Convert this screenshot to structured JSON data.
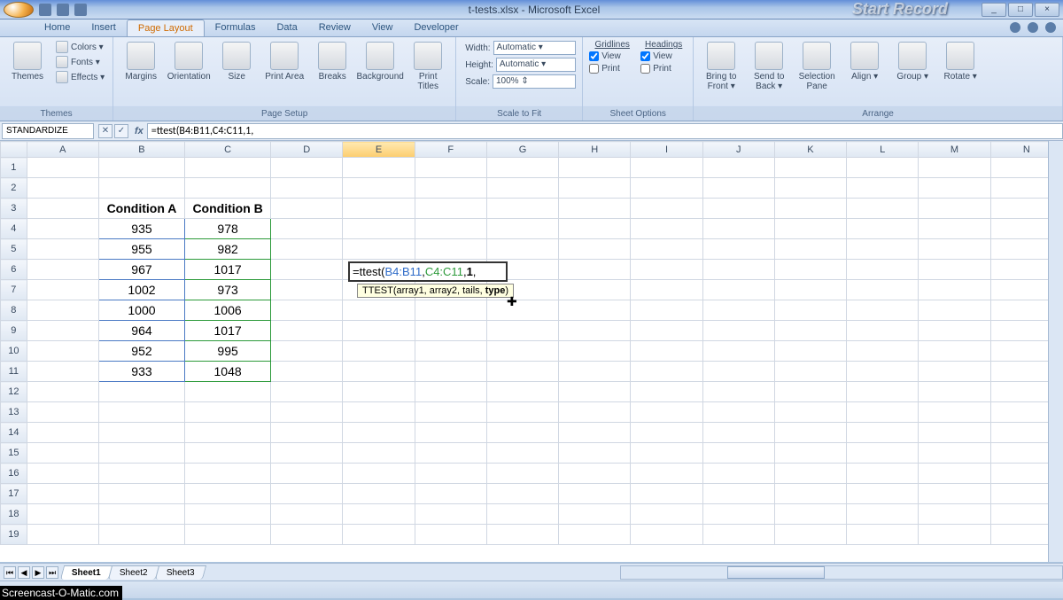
{
  "title": "t-tests.xlsx - Microsoft Excel",
  "watermark_top": "Start Record",
  "watermark_bottom": "Screencast-O-Matic.com",
  "window_buttons": {
    "min": "_",
    "max": "□",
    "close": "×"
  },
  "tabs": [
    "Home",
    "Insert",
    "Page Layout",
    "Formulas",
    "Data",
    "Review",
    "View",
    "Developer"
  ],
  "active_tab": 2,
  "ribbon": {
    "themes": {
      "label": "Themes",
      "btn": "Themes",
      "rows": [
        "Colors ▾",
        "Fonts ▾",
        "Effects ▾"
      ]
    },
    "page_setup": {
      "label": "Page Setup",
      "buttons": [
        "Margins",
        "Orientation",
        "Size",
        "Print Area",
        "Breaks",
        "Background",
        "Print Titles"
      ]
    },
    "scale": {
      "label": "Scale to Fit",
      "width_l": "Width:",
      "width_v": "Automatic ▾",
      "height_l": "Height:",
      "height_v": "Automatic ▾",
      "scale_l": "Scale:",
      "scale_v": "100% ⇕"
    },
    "sheet_options": {
      "label": "Sheet Options",
      "grid": "Gridlines",
      "head": "Headings",
      "view": "View",
      "print": "Print"
    },
    "arrange": {
      "label": "Arrange",
      "buttons": [
        "Bring to Front ▾",
        "Send to Back ▾",
        "Selection Pane",
        "Align ▾",
        "Group ▾",
        "Rotate ▾"
      ]
    }
  },
  "formula_bar": {
    "namebox": "STANDARDIZE",
    "formula": "=ttest(B4:B11,C4:C11,1,"
  },
  "grid": {
    "columns": [
      "A",
      "B",
      "C",
      "D",
      "E",
      "F",
      "G",
      "H",
      "I",
      "J",
      "K",
      "L",
      "M",
      "N"
    ],
    "active_col_index": 4,
    "rows": 19,
    "headers": {
      "b3": "Condition A",
      "c3": "Condition B"
    },
    "data_b": [
      "935",
      "955",
      "967",
      "1002",
      "1000",
      "964",
      "952",
      "933"
    ],
    "data_c": [
      "978",
      "982",
      "1017",
      "973",
      "1006",
      "1017",
      "995",
      "1048"
    ]
  },
  "cell_edit": {
    "pre": "=ttest(",
    "r1": "B4:B11",
    "sep1": ",",
    "r2": "C4:C11",
    "sep2": ",",
    "tails": "1",
    "trail": ","
  },
  "tooltip": {
    "fn": "TTEST",
    "args": "(array1, array2, tails, ",
    "bold": "type",
    "end": ")"
  },
  "sheet_tabs": [
    "Sheet1",
    "Sheet2",
    "Sheet3"
  ],
  "nav_glyphs": [
    "⏮",
    "◀",
    "▶",
    "⏭"
  ]
}
